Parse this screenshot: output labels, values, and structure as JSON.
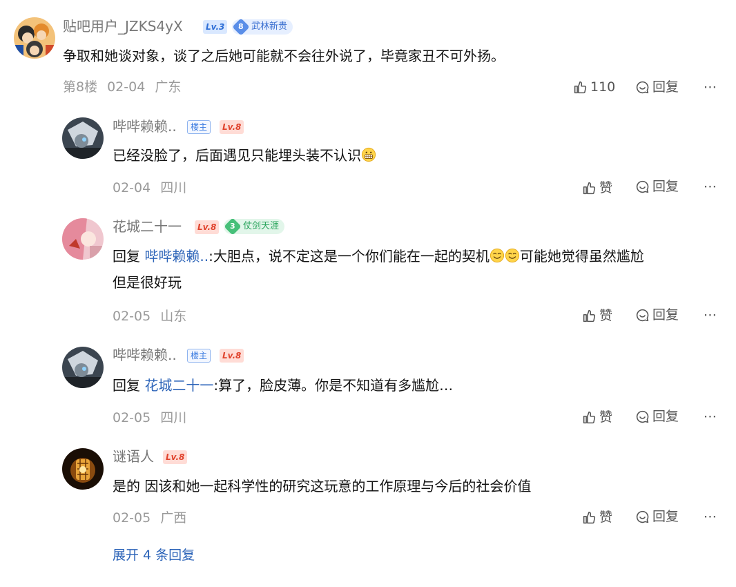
{
  "main_post": {
    "username": "贴吧用户_JZKS4yX",
    "level": "Lv.3",
    "title_badge_num": "8",
    "title_badge": "武林新贵",
    "content": "争取和她谈对象，谈了之后她可能就不会往外说了，毕竟家丑不可外扬。",
    "floor": "第8楼",
    "date": "02-04",
    "location": "广东",
    "like_count": "110",
    "reply_label": "回复",
    "more": "⋯"
  },
  "replies": [
    {
      "username": "哔哔赖赖..",
      "owner_badge": "楼主",
      "level": "Lv.8",
      "content": "已经没脸了，后面遇见只能埋头装不认识",
      "date": "02-04",
      "location": "四川",
      "like_label": "赞",
      "reply_label": "回复",
      "more": "⋯"
    },
    {
      "username": "花城二十一",
      "level": "Lv.8",
      "title_badge_num": "3",
      "title_badge": "仗剑天涯",
      "reply_prefix": "回复",
      "mention": "哔哔赖赖..",
      "content_a": ":大胆点，说不定这是一个你们能在一起的契机",
      "content_b": "可能她觉得虽然尴尬",
      "content_c": "但是很好玩",
      "date": "02-05",
      "location": "山东",
      "like_label": "赞",
      "reply_label": "回复",
      "more": "⋯"
    },
    {
      "username": "哔哔赖赖..",
      "owner_badge": "楼主",
      "level": "Lv.8",
      "reply_prefix": "回复",
      "mention": "花城二十一",
      "content": ":算了，脸皮薄。你是不知道有多尴尬…",
      "date": "02-05",
      "location": "四川",
      "like_label": "赞",
      "reply_label": "回复",
      "more": "⋯"
    },
    {
      "username": "谜语人",
      "level": "Lv.8",
      "content": "是的 因该和她一起科学性的研究这玩意的工作原理与今后的社会价值",
      "date": "02-05",
      "location": "广西",
      "like_label": "赞",
      "reply_label": "回复",
      "more": "⋯"
    }
  ],
  "expand_label": "展开 4 条回复",
  "colors": {
    "mention": "#2b63b8",
    "level_blue": "#2f6fd6",
    "level_red": "#e0432d",
    "meta_gray": "#9a9a9a"
  },
  "icons": [
    "thumbs-up-icon",
    "comment-icon",
    "more-icon",
    "grimace-emoji",
    "smile-emoji"
  ]
}
